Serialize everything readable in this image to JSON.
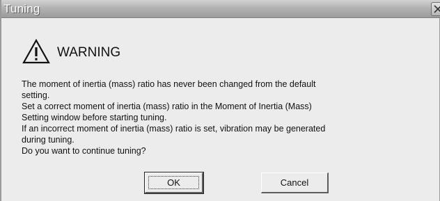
{
  "window": {
    "title": "Tuning"
  },
  "warning": {
    "icon": "warning-triangle-icon",
    "title": "WARNING"
  },
  "message": {
    "lines": [
      "The moment of inertia (mass) ratio has never been changed from the default",
      "setting.",
      "Set a correct moment of inertia (mass) ratio in the Moment of Inertia (Mass)",
      "Setting window before starting tuning.",
      "If an incorrect moment of inertia (mass) ratio is set, vibration may be generated",
      "during tuning.",
      "Do you want to continue tuning?"
    ]
  },
  "buttons": {
    "ok_label": "OK",
    "cancel_label": "Cancel"
  }
}
